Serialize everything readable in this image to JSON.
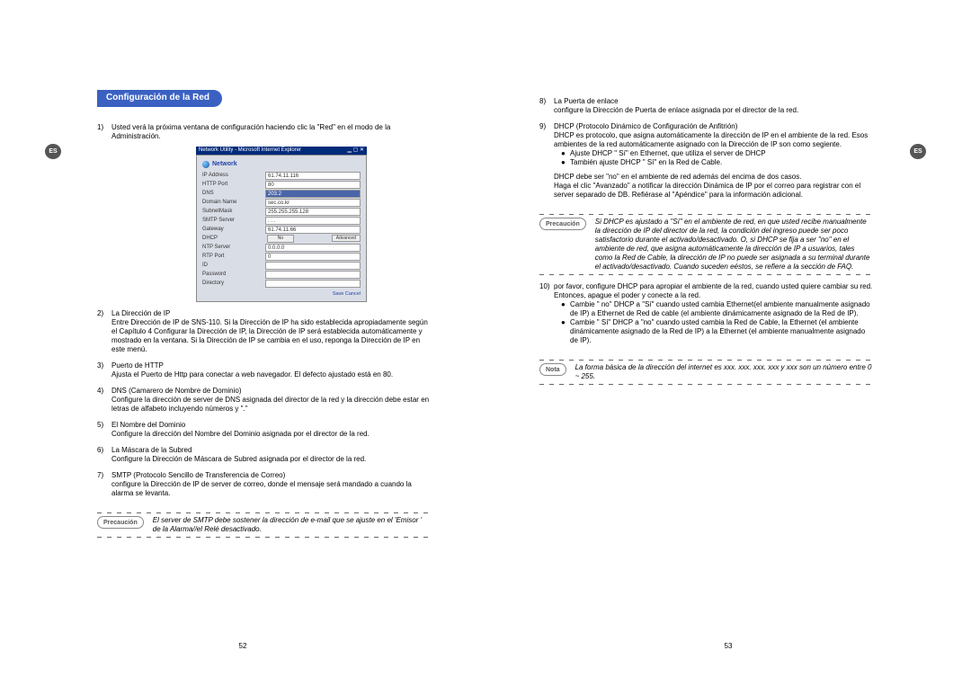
{
  "side_label": "ES",
  "left": {
    "title": "Configuración de la Red",
    "items": [
      {
        "n": "1)",
        "title": "",
        "desc": "Usted verá la próxima ventana de configuración haciendo clic la \"Red\" en el modo de la Administración."
      },
      {
        "n": "2)",
        "title": "La Dirección de IP",
        "desc": "Entre Dirección de IP de SNS-110. Si la Dirección de IP ha sido establecida apropiadamente según el Capítulo 4 Configurar la Dirección de IP, la Dirección de IP será establecida automáticamente y mostrado en la ventana. Si la Dirección de IP se cambia en el uso, reponga la Dirección de IP en este menú."
      },
      {
        "n": "3)",
        "title": "Puerto de HTTP",
        "desc": "Ajusta el Puerto de Http para conectar a web navegador. El defecto ajustado está en 80."
      },
      {
        "n": "4)",
        "title": "DNS (Camarero de Nombre de Dominio)",
        "desc": "Configure la dirección de server de DNS asignada del director de la red y la dirección debe estar en letras de alfabeto incluyendo números y \".\""
      },
      {
        "n": "5)",
        "title": "El Nombre del Dominio",
        "desc": "Configure la dirección del Nombre del Dominio asignada por el director de la red."
      },
      {
        "n": "6)",
        "title": "La Máscara de la Subred",
        "desc": "Configure la Dirección de Máscara de Subred asignada por el director de la red."
      },
      {
        "n": "7)",
        "title": "SMTP (Protocolo Sencillo de Transferencia de Correo)",
        "desc": "configure la Dirección de IP de server de correo, donde el mensaje será mandado a cuando la alarma se levanta."
      }
    ],
    "callout_label": "Precaución",
    "callout_text": "El server de SMTP debe sostener la dirección de e-mail que se ajuste en el 'Emisor ' de la Alarma//el Relé desactivado.",
    "page_num": "52",
    "screenshot": {
      "window_title": "Network Utility - Microsoft Internet Explorer",
      "section": "Network",
      "rows": [
        {
          "label": "IP Address",
          "value": "61.74.11.116"
        },
        {
          "label": "HTTP Port",
          "value": "80"
        },
        {
          "label": "DNS",
          "value": "203.2"
        },
        {
          "label": "Domain Name",
          "value": "sec.co.kr"
        },
        {
          "label": "SubnetMask",
          "value": "255.255.255.128"
        },
        {
          "label": "SMTP Server",
          "value": "   .   .   .   "
        },
        {
          "label": "Gateway",
          "value": "61.74.11.66"
        }
      ],
      "dhcp_row": {
        "label": "DHCP",
        "value": "No",
        "extra": "Advanced"
      },
      "rows2": [
        {
          "label": "NTP Server",
          "value": "0.0.0.0"
        },
        {
          "label": "RTP Port",
          "value": "0"
        },
        {
          "label": "ID",
          "value": ""
        },
        {
          "label": "Password",
          "value": ""
        },
        {
          "label": "Directory",
          "value": ""
        }
      ],
      "footer_links": "Save   Cancel"
    }
  },
  "right": {
    "items": [
      {
        "n": "8)",
        "title": "La Puerta de enlace",
        "desc": "configure la Dirección de Puerta de enlace asignada por el director de la red."
      },
      {
        "n": "9)",
        "title": "DHCP (Protocolo Dinámico de Configuración de Anfitrión)",
        "desc": "DHCP es protocolo, que asigna automáticamente la dirección de IP en el ambiente de la red. Esos ambientes de la red automáticamente asignado con la Dirección de IP son como segiente.",
        "bullets": [
          "Ajuste DHCP \" Sí\" en Ethernet, que utiliza el server de DHCP",
          "También ajuste DHCP \" Sí\" en la Red de Cable."
        ],
        "after": "DHCP debe ser \"no\" en el ambiente de red además del encima de dos casos.\nHaga el clic \"Avanzado\" a notificar la dirección Dinámica de IP por el correo para registrar con el server separado de DB. Refiérase al \"Apéndice\" para la información adicional."
      }
    ],
    "callout1_label": "Precaución",
    "callout1_text": "Si DHCP es ajustado a \"Sí\" en el ambiente de red, en que usted recibe manualmente la dirección de IP del director de la red, la condición del ingreso puede ser poco satisfactorio durante el activado/desactivado. O, si DHCP se fija a ser \"no\" en el ambiente de red, que asigna automáticamente la dirección de IP a usuarios, tales como la Red de Cable, la dirección de IP no puede ser asignada a su terminal durante el activado/desactivado. Cuando suceden eéstos, se refiere a la sección de FAQ.",
    "item10": {
      "n": "10)",
      "desc": "por favor, configure DHCP para apropiar el ambiente de la red, cuando usted quiere cambiar su red.\nEntonces, apague el poder y conecte a la red.",
      "bullets": [
        "Cambie \" no\" DHCP a \"Sí\" cuando usted cambia Ethernet(el ambiente manualmente asignado de IP) a Ethernet de Red de cable (el ambiente dinámicamente asignado de la Red de IP).",
        "Cambie \" Sí\" DHCP a \"no\" cuando usted cambia la Red de Cable, la Ethernet (el ambiente dinámicamente asignado de la Red de IP) a la Ethernet (el ambiente manualmente asignado de IP)."
      ]
    },
    "callout2_label": "Nota",
    "callout2_text": "La forma básica de la dirección del internet es xxx. xxx. xxx. xxx y xxx son un número entre 0 ~ 255.",
    "page_num": "53"
  }
}
